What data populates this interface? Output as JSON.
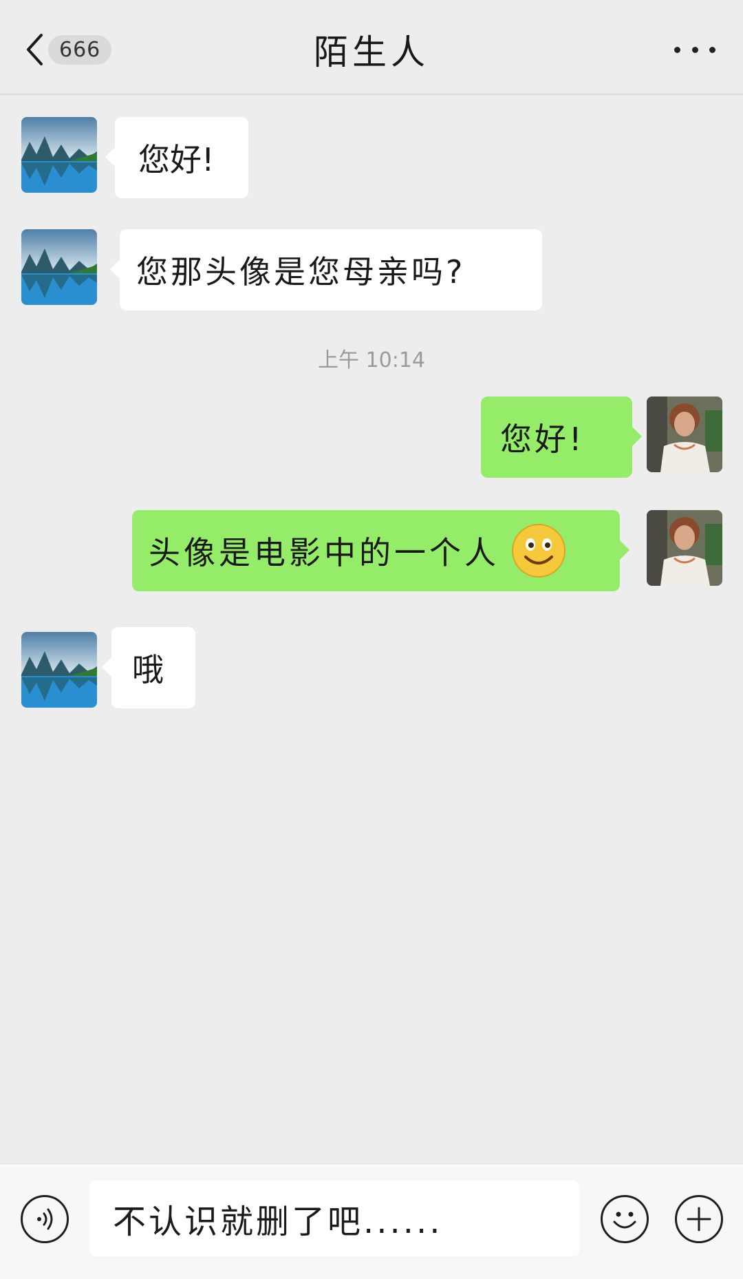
{
  "header": {
    "unread_count": "666",
    "title": "陌生人"
  },
  "time_divider": "上午 10:14",
  "messages": [
    {
      "side": "in",
      "text": "您好!"
    },
    {
      "side": "in",
      "text": "您那头像是您母亲吗?"
    },
    {
      "side": "out",
      "text": "您好!"
    },
    {
      "side": "out",
      "text": "头像是电影中的一个人",
      "emoji": "smile-emoji"
    },
    {
      "side": "in",
      "text": "哦"
    }
  ],
  "input": {
    "value": "不认识就删了吧......"
  },
  "icons": {
    "back": "chevron-left-icon",
    "more": "more-dots-icon",
    "voice": "voice-icon",
    "emoji": "emoji-icon",
    "plus": "plus-icon"
  },
  "colors": {
    "outgoing_bubble": "#95ec69",
    "incoming_bubble": "#ffffff",
    "background": "#ededed"
  }
}
